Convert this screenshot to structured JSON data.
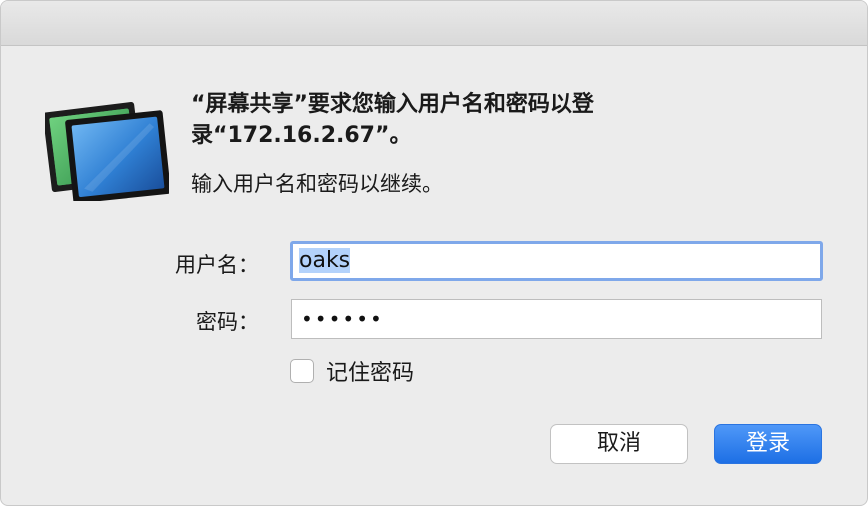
{
  "dialog": {
    "headline": "“屏幕共享”要求您输入用户名和密码以登录“172.16.2.67”。",
    "subtext": "输入用户名和密码以继续。"
  },
  "form": {
    "username_label": "用户名：",
    "username_value": "oaks",
    "password_label": "密码：",
    "password_value": "••••••",
    "remember_label": "记住密码",
    "remember_checked": false
  },
  "buttons": {
    "cancel_label": "取消",
    "login_label": "登录"
  },
  "colors": {
    "accent": "#1d6fe5",
    "focus_ring": "#7fa8ea",
    "selection": "#b3d2fb"
  },
  "icons": {
    "app_icon": "screen-sharing-icon"
  }
}
